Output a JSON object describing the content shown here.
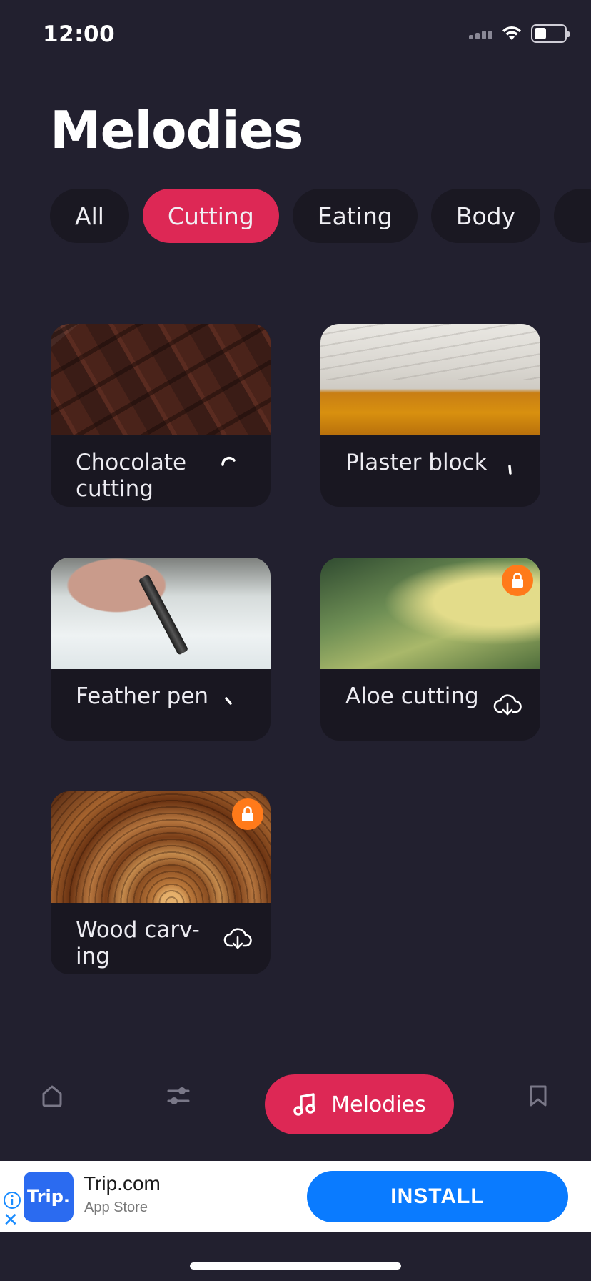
{
  "status_bar": {
    "time": "12:00"
  },
  "header": {
    "title": "Melodies"
  },
  "filters": [
    {
      "label": "All",
      "active": false
    },
    {
      "label": "Cutting",
      "active": true
    },
    {
      "label": "Eating",
      "active": false
    },
    {
      "label": "Body",
      "active": false
    }
  ],
  "cards": [
    {
      "title": "Chocolate cutting",
      "action_icon": "loading-spinner-icon",
      "locked": false
    },
    {
      "title": "Plaster block",
      "action_icon": "loading-spinner-icon",
      "locked": false
    },
    {
      "title": "Feather pen",
      "action_icon": "loading-spinner-icon",
      "locked": false
    },
    {
      "title": "Aloe cutting",
      "action_icon": "cloud-download-icon",
      "locked": true
    },
    {
      "title": "Wood carv-ing",
      "action_icon": "cloud-download-icon",
      "locked": true
    }
  ],
  "bottom_nav": {
    "items": [
      {
        "icon": "home-icon"
      },
      {
        "icon": "sliders-icon"
      },
      {
        "icon": "music-note-icon",
        "label": "Melodies",
        "active": true
      },
      {
        "icon": "bookmark-icon"
      }
    ]
  },
  "ad": {
    "logo_text": "Trip.",
    "title": "Trip.com",
    "subtitle": "App Store",
    "install_label": "INSTALL",
    "close_symbol": "✕"
  },
  "colors": {
    "background": "#22202f",
    "accent": "#dd2855",
    "lock_badge": "#ff7a1a",
    "install_button": "#0a7bff"
  }
}
